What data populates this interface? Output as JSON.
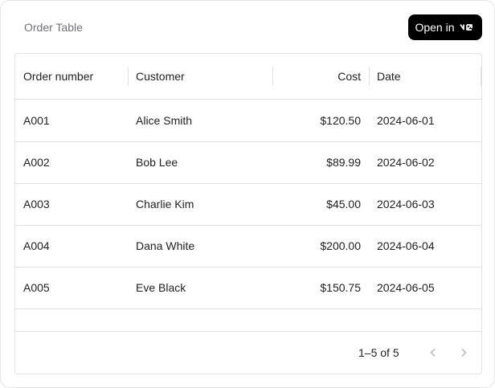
{
  "card": {
    "title": "Order Table",
    "open_label": "Open in",
    "open_icon": "v0-logo-icon"
  },
  "table": {
    "columns": [
      "Order number",
      "Customer",
      "Cost",
      "Date"
    ],
    "rows": [
      [
        "A001",
        "Alice Smith",
        "$120.50",
        "2024-06-01"
      ],
      [
        "A002",
        "Bob Lee",
        "$89.99",
        "2024-06-02"
      ],
      [
        "A003",
        "Charlie Kim",
        "$45.00",
        "2024-06-03"
      ],
      [
        "A004",
        "Dana White",
        "$200.00",
        "2024-06-04"
      ],
      [
        "A005",
        "Eve Black",
        "$150.75",
        "2024-06-05"
      ]
    ]
  },
  "pagination": {
    "range": "1–5 of 5",
    "prev_icon": "chevron-left-icon",
    "next_icon": "chevron-right-icon"
  }
}
